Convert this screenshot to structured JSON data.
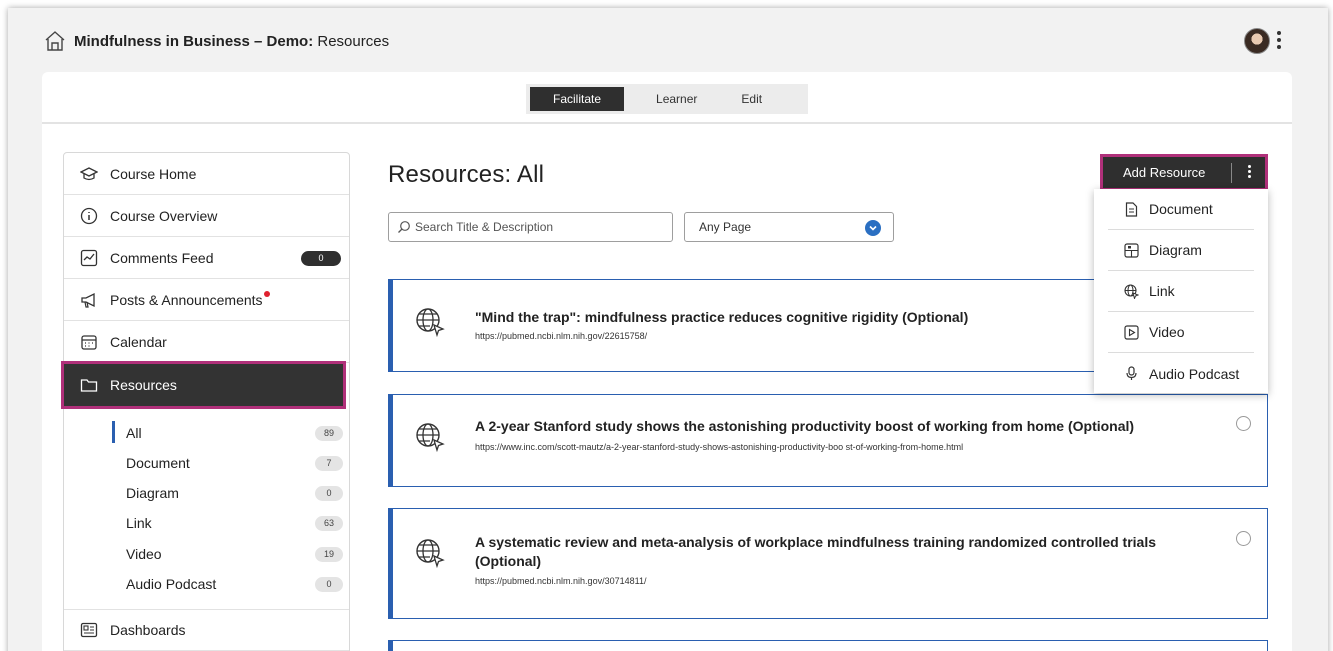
{
  "window": {
    "course_title": "Mindfulness in Business – Demo:",
    "section_title": " Resources"
  },
  "modes": [
    {
      "label": "Facilitate",
      "active": true
    },
    {
      "label": "Learner",
      "active": false
    },
    {
      "label": "Edit",
      "active": false
    }
  ],
  "sidebar": {
    "items": [
      {
        "label": "Course Home",
        "icon": "graduation-cap-icon"
      },
      {
        "label": "Course Overview",
        "icon": "info-icon"
      },
      {
        "label": "Comments Feed",
        "icon": "comments-feed-icon",
        "badge": "0"
      },
      {
        "label": "Posts & Announcements",
        "icon": "megaphone-icon",
        "dot": true
      },
      {
        "label": "Calendar",
        "icon": "calendar-icon"
      },
      {
        "label": "Resources",
        "icon": "folder-icon",
        "active": true
      },
      {
        "label": "Dashboards",
        "icon": "dashboard-icon"
      }
    ],
    "resource_filters": [
      {
        "label": "All",
        "count": "89",
        "active": true
      },
      {
        "label": "Document",
        "count": "7"
      },
      {
        "label": "Diagram",
        "count": "0"
      },
      {
        "label": "Link",
        "count": "63"
      },
      {
        "label": "Video",
        "count": "19"
      },
      {
        "label": "Audio Podcast",
        "count": "0"
      }
    ]
  },
  "main": {
    "title": "Resources: All",
    "search_placeholder": "Search Title & Description",
    "page_filter": "Any Page",
    "add_button_label": "Add Resource",
    "add_menu": [
      {
        "label": "Document",
        "icon": "document-icon"
      },
      {
        "label": "Diagram",
        "icon": "diagram-icon"
      },
      {
        "label": "Link",
        "icon": "link-globe-icon"
      },
      {
        "label": "Video",
        "icon": "video-icon"
      },
      {
        "label": "Audio Podcast",
        "icon": "microphone-icon"
      }
    ],
    "resources": [
      {
        "title": "\"Mind the trap\": mindfulness practice reduces cognitive rigidity (Optional)",
        "url": "https://pubmed.ncbi.nlm.nih.gov/22615758/"
      },
      {
        "title": "A 2-year Stanford study shows the astonishing productivity boost of working from home (Optional)",
        "url": "https://www.inc.com/scott-mautz/a-2-year-stanford-study-shows-astonishing-productivity-boo st-of-working-from-home.html"
      },
      {
        "title": "A systematic review and meta-analysis of workplace mindfulness training randomized controlled trials (Optional)",
        "url": "https://pubmed.ncbi.nlm.nih.gov/30714811/"
      }
    ]
  },
  "colors": {
    "accent_highlight": "#b0307a",
    "link_blue": "#2a5fb0",
    "dark": "#2f2f2f",
    "notification_red": "#e0212f"
  }
}
